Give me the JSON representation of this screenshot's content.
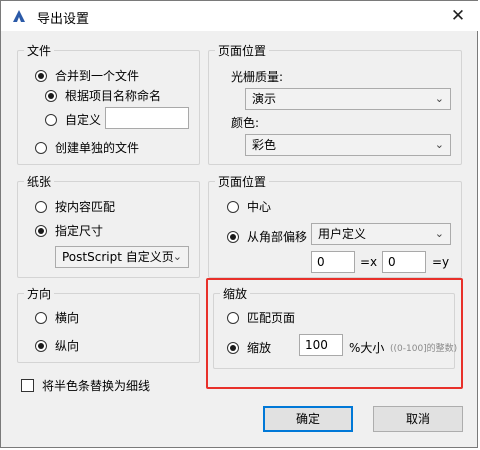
{
  "window": {
    "title": "导出设置",
    "close_glyph": "✕",
    "icon": "revit-app-icon"
  },
  "file_group": {
    "label": "文件",
    "merge_label": "合并到一个文件",
    "name_by_project_label": "根据项目名称命名",
    "custom_label": "自定义",
    "custom_value": "",
    "separate_label": "创建单独的文件"
  },
  "page_position_top": {
    "label": "页面位置",
    "raster_quality_label": "光栅质量:",
    "raster_quality_value": "演示",
    "color_label": "颜色:",
    "color_value": "彩色"
  },
  "paper_group": {
    "label": "纸张",
    "fit_label": "按内容匹配",
    "size_label": "指定尺寸",
    "size_value": "PostScript 自定义页"
  },
  "page_position_bottom": {
    "label": "页面位置",
    "center_label": "中心",
    "offset_label": "从角部偏移",
    "offset_value": "用户定义",
    "x_value": "0",
    "x_unit": "=x",
    "y_value": "0",
    "y_unit": "=y"
  },
  "direction_group": {
    "label": "方向",
    "landscape_label": "横向",
    "portrait_label": "纵向"
  },
  "zoom_group": {
    "label": "缩放",
    "fit_page_label": "匹配页面",
    "zoom_label": "缩放",
    "zoom_value": "100",
    "unit_label": "%大小",
    "hint": "((0-100]的整数)"
  },
  "halftone_label": "将半色条替换为细线",
  "buttons": {
    "ok": "确定",
    "cancel": "取消"
  },
  "colors": {
    "highlight": "#e8302a",
    "accent": "#0078d7",
    "app_icon": "#2b5aa8"
  }
}
